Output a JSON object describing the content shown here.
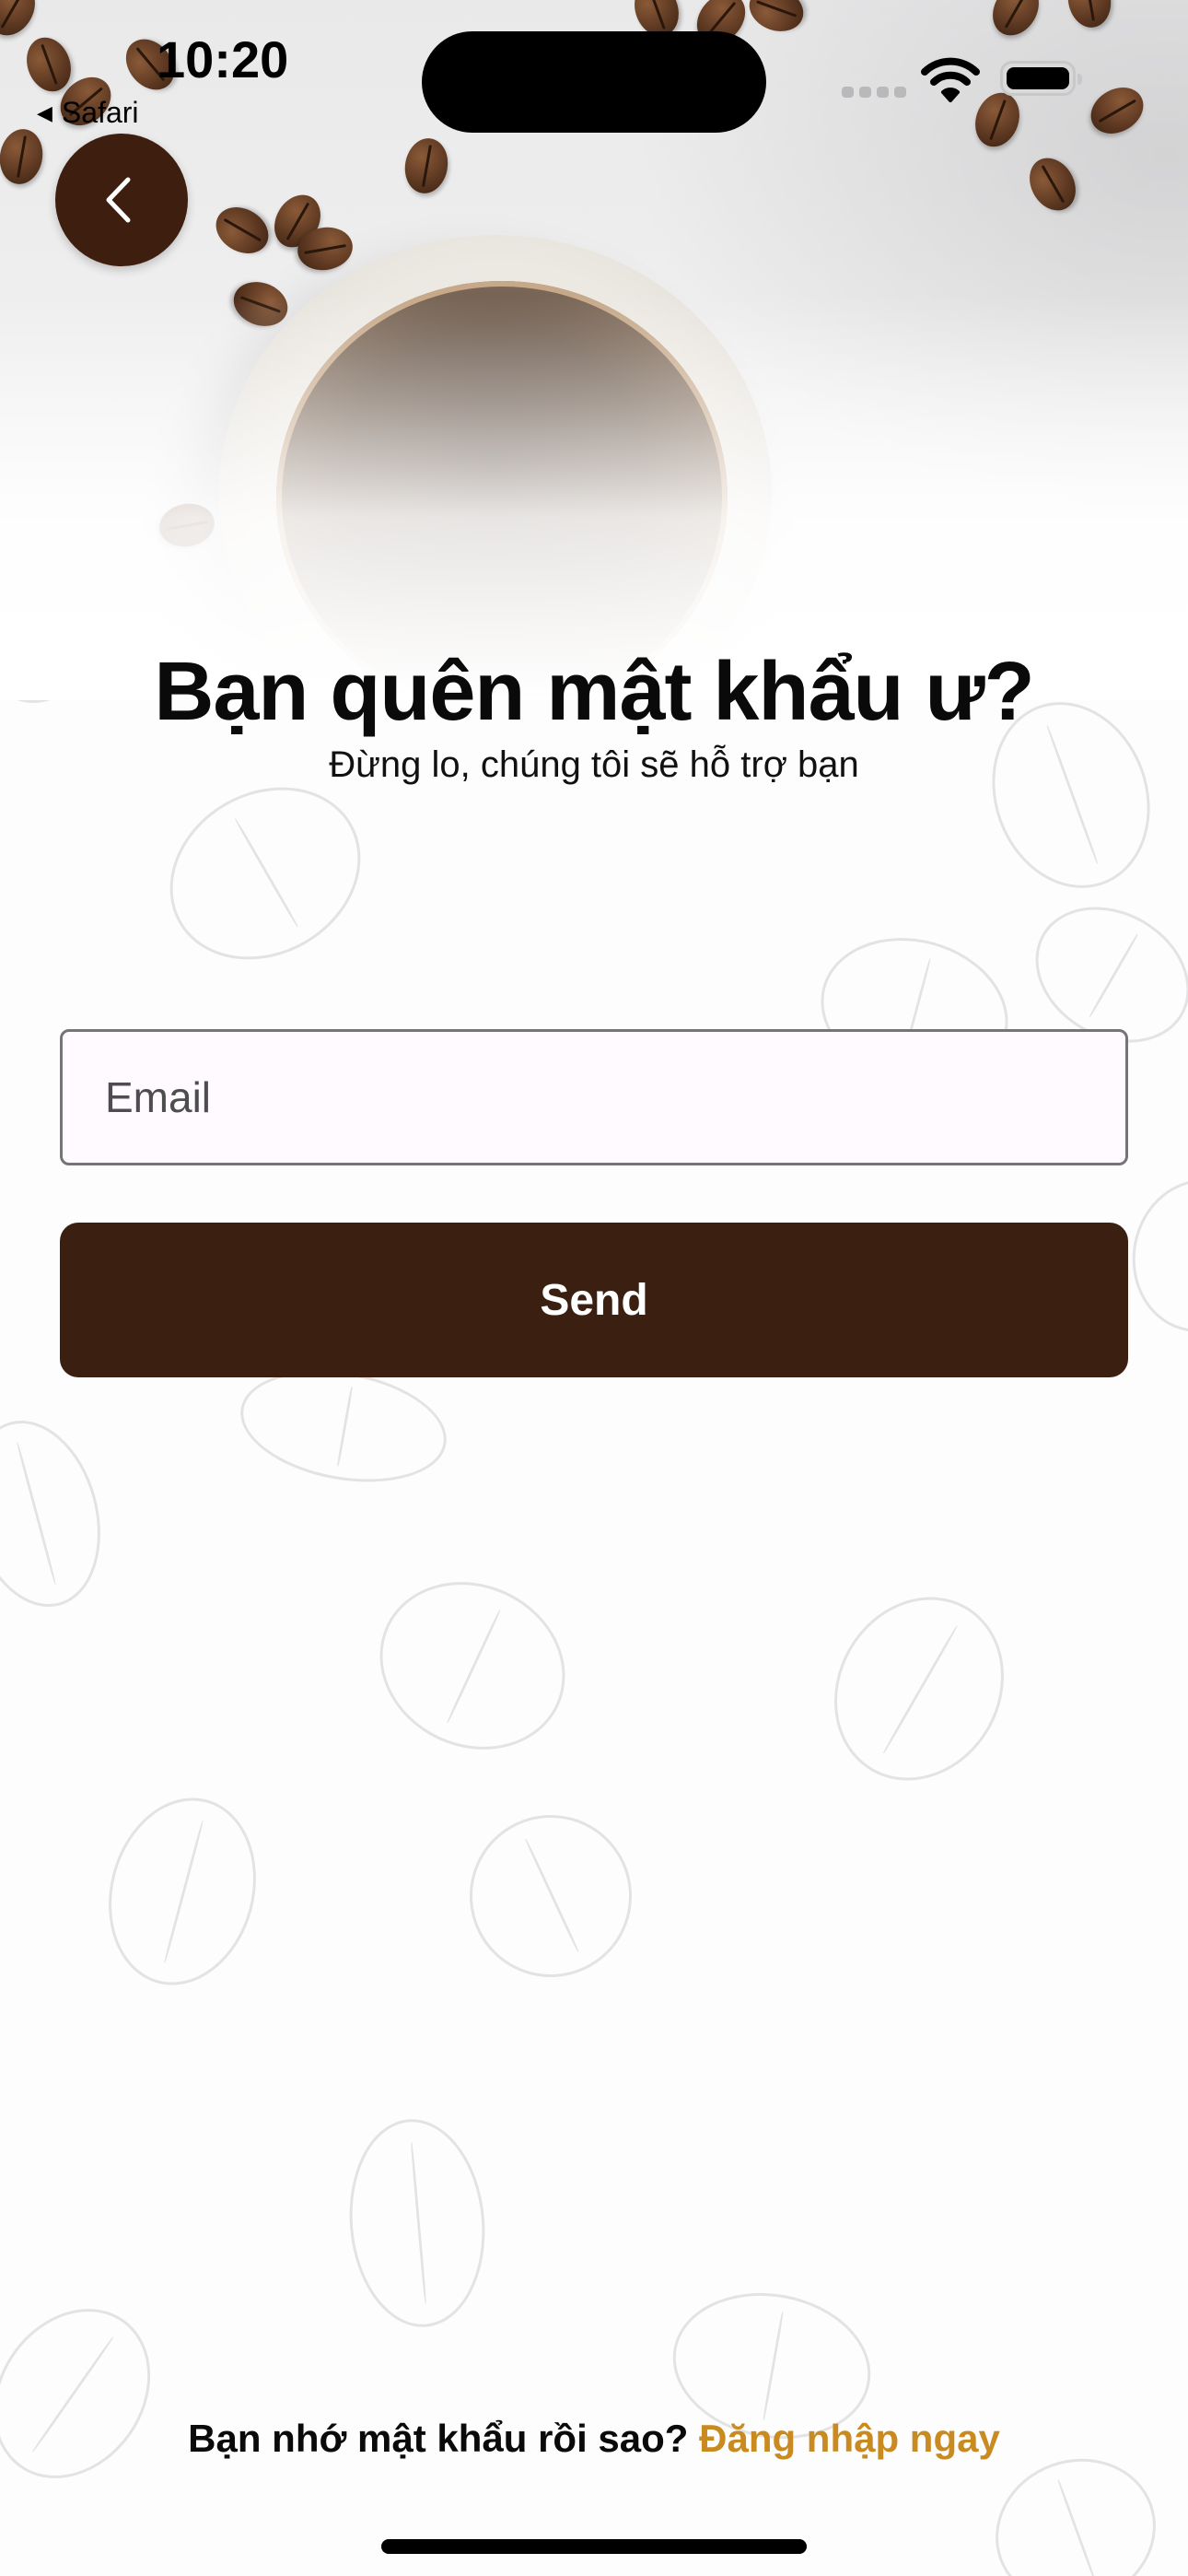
{
  "status_bar": {
    "time": "10:20",
    "back_app": "Safari",
    "back_glyph": "◀",
    "icons": [
      "cellular-signal-icon",
      "wifi-icon",
      "battery-icon"
    ]
  },
  "nav": {
    "back_icon": "chevron-left-icon"
  },
  "heading": {
    "title": "Bạn quên mật khẩu ư?",
    "subtitle": "Đừng lo, chúng tôi sẽ hỗ trợ bạn"
  },
  "form": {
    "email_placeholder": "Email",
    "email_value": "",
    "send_label": "Send"
  },
  "footer": {
    "question": "Bạn nhớ mật khẩu rồi sao?",
    "login_link": "Đăng nhập ngay"
  },
  "colors": {
    "primary_brown": "#3b1f10",
    "accent_gold": "#c98a1f",
    "field_background": "#fffaff"
  }
}
